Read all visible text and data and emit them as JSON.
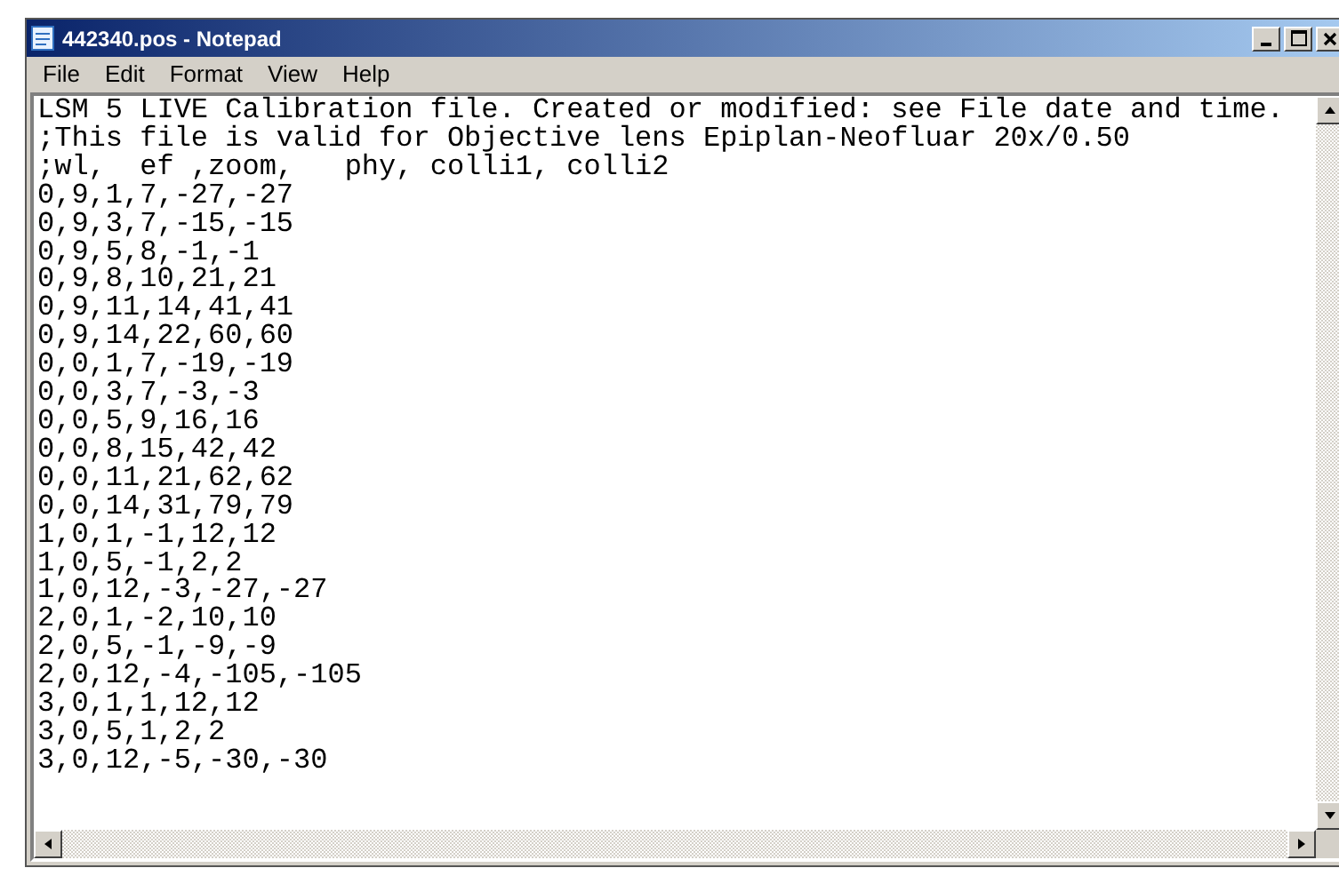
{
  "window": {
    "title": "442340.pos - Notepad"
  },
  "menu": [
    {
      "label": "File"
    },
    {
      "label": "Edit"
    },
    {
      "label": "Format"
    },
    {
      "label": "View"
    },
    {
      "label": "Help"
    }
  ],
  "document": {
    "lines": [
      "LSM 5 LIVE Calibration file. Created or modified: see File date and time.",
      ";This file is valid for Objective lens Epiplan-Neofluar 20x/0.50",
      ";wl,  ef ,zoom,   phy, colli1, colli2",
      "0,9,1,7,-27,-27",
      "0,9,3,7,-15,-15",
      "0,9,5,8,-1,-1",
      "0,9,8,10,21,21",
      "0,9,11,14,41,41",
      "0,9,14,22,60,60",
      "0,0,1,7,-19,-19",
      "0,0,3,7,-3,-3",
      "0,0,5,9,16,16",
      "0,0,8,15,42,42",
      "0,0,11,21,62,62",
      "0,0,14,31,79,79",
      "1,0,1,-1,12,12",
      "1,0,5,-1,2,2",
      "1,0,12,-3,-27,-27",
      "2,0,1,-2,10,10",
      "2,0,5,-1,-9,-9",
      "2,0,12,-4,-105,-105",
      "3,0,1,1,12,12",
      "3,0,5,1,2,2",
      "3,0,12,-5,-30,-30"
    ]
  }
}
